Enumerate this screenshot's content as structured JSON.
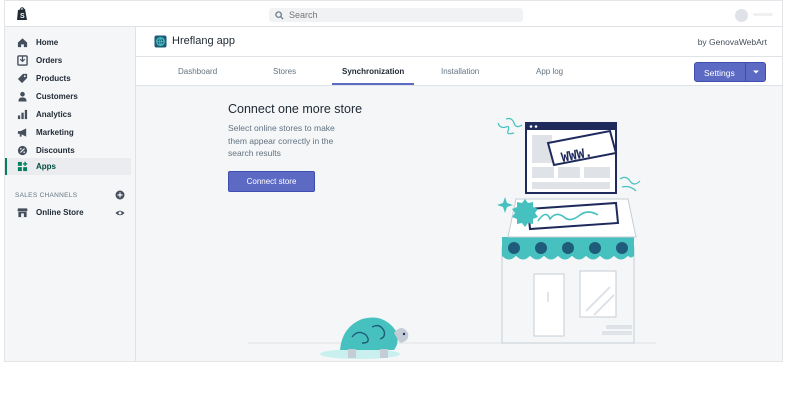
{
  "topbar": {
    "search_placeholder": "Search"
  },
  "sidebar": {
    "items": [
      {
        "label": "Home",
        "icon": "home-icon"
      },
      {
        "label": "Orders",
        "icon": "orders-icon"
      },
      {
        "label": "Products",
        "icon": "tag-icon"
      },
      {
        "label": "Customers",
        "icon": "person-icon"
      },
      {
        "label": "Analytics",
        "icon": "bar-chart-icon"
      },
      {
        "label": "Marketing",
        "icon": "megaphone-icon"
      },
      {
        "label": "Discounts",
        "icon": "discount-icon"
      },
      {
        "label": "Apps",
        "icon": "apps-icon",
        "active": true
      }
    ],
    "sales_channels_label": "SALES CHANNELS",
    "channels": [
      {
        "label": "Online Store",
        "icon": "store-icon"
      }
    ]
  },
  "app": {
    "title": "Hreflang app",
    "by": "by GenovaWebArt"
  },
  "tabs": [
    {
      "label": "Dashboard"
    },
    {
      "label": "Stores"
    },
    {
      "label": "Synchronization",
      "active": true
    },
    {
      "label": "Installation"
    },
    {
      "label": "App log"
    }
  ],
  "settings_button": {
    "label": "Settings"
  },
  "content": {
    "title": "Connect one more store",
    "body": "Select online stores to make them appear correctly in the search results",
    "button_label": "Connect store"
  },
  "illustration": {
    "sign_text": "WWW."
  },
  "colors": {
    "accent": "#5c6ac4",
    "teal": "#47c1bf",
    "navy": "#1f2a5c",
    "active_green": "#008060"
  }
}
